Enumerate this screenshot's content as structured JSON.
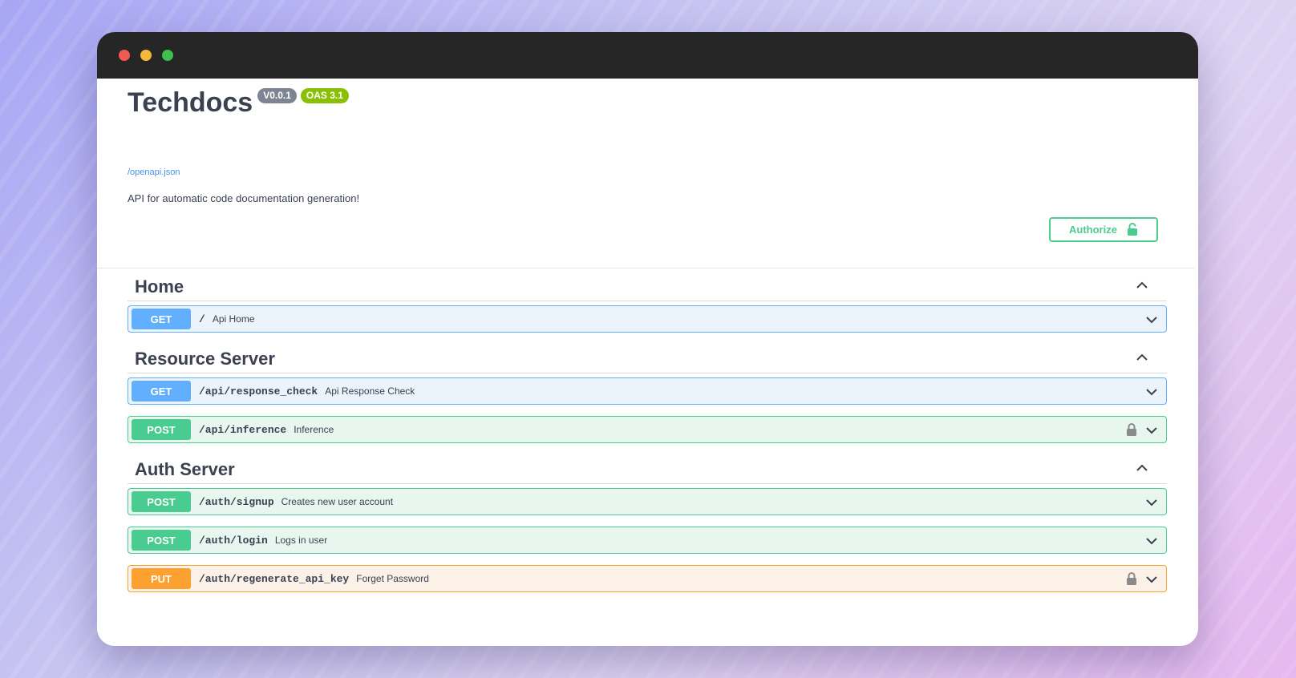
{
  "app": {
    "title": "Techdocs",
    "version_badge": "V0.0.1",
    "oas_badge": "OAS 3.1",
    "spec_link": "/openapi.json",
    "description": "API for automatic code documentation generation!",
    "authorize_label": "Authorize"
  },
  "sections": [
    {
      "title": "Home",
      "operations": [
        {
          "method": "GET",
          "path": "/",
          "summary": "Api Home",
          "locked": false
        }
      ]
    },
    {
      "title": "Resource Server",
      "operations": [
        {
          "method": "GET",
          "path": "/api/response_check",
          "summary": "Api Response Check",
          "locked": false
        },
        {
          "method": "POST",
          "path": "/api/inference",
          "summary": "Inference",
          "locked": true
        }
      ]
    },
    {
      "title": "Auth Server",
      "operations": [
        {
          "method": "POST",
          "path": "/auth/signup",
          "summary": "Creates new user account",
          "locked": false
        },
        {
          "method": "POST",
          "path": "/auth/login",
          "summary": "Logs in user",
          "locked": false
        },
        {
          "method": "PUT",
          "path": "/auth/regenerate_api_key",
          "summary": "Forget Password",
          "locked": true
        }
      ]
    }
  ],
  "colors": {
    "get": "#61affe",
    "post": "#49cc90",
    "put": "#fca130",
    "text": "#3b4151",
    "link": "#4990e2",
    "oas_badge": "#89bf04",
    "version_badge": "#7d8492"
  },
  "icons": {
    "authorize": "unlock-icon",
    "operation_lock": "lock-icon",
    "section_toggle": "chevron-up-icon",
    "operation_toggle": "chevron-down-icon"
  }
}
